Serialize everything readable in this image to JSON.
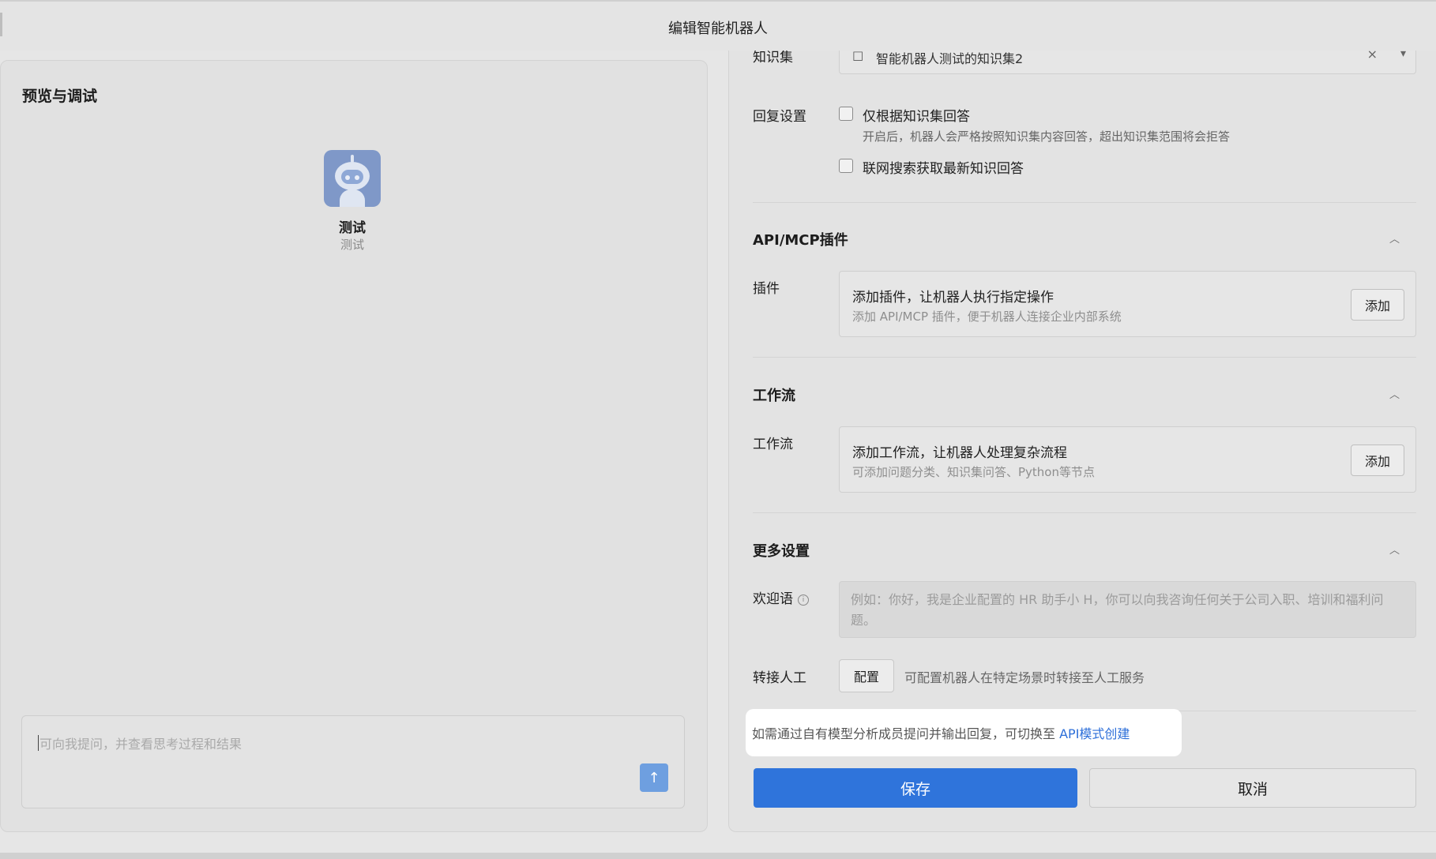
{
  "window": {
    "title": "编辑智能机器人"
  },
  "preview": {
    "title": "预览与调试",
    "bot": {
      "name": "测试",
      "description": "测试"
    },
    "input_placeholder": "可向我提问，并查看思考过程和结果",
    "send_icon": "arrow-up-icon"
  },
  "config": {
    "knowledge": {
      "label": "知识集",
      "value": "智能机器人测试的知识集2",
      "clear_icon": "×",
      "chevron": "⌄"
    },
    "reply": {
      "label": "回复设置",
      "only_kb": {
        "label": "仅根据知识集回答",
        "checked": false,
        "hint": "开启后，机器人会严格按照知识集内容回答，超出知识集范围将会拒答"
      },
      "web_search": {
        "label": "联网搜索获取最新知识回答",
        "checked": false
      }
    },
    "plugins": {
      "section_title": "API/MCP插件",
      "label": "插件",
      "card_title": "添加插件，让机器人执行指定操作",
      "card_desc": "添加 API/MCP 插件，便于机器人连接企业内部系统",
      "add_label": "添加"
    },
    "workflow": {
      "section_title": "工作流",
      "label": "工作流",
      "card_title": "添加工作流，让机器人处理复杂流程",
      "card_desc": "可添加问题分类、知识集问答、Python等节点",
      "add_label": "添加"
    },
    "more": {
      "section_title": "更多设置",
      "greeting_label": "欢迎语",
      "greeting_placeholder": "例如：你好，我是企业配置的 HR 助手小 H，你可以向我咨询任何关于公司入职、培训和福利问题。",
      "handoff_label": "转接人工",
      "handoff_button": "配置",
      "handoff_hint": "可配置机器人在特定场景时转接至人工服务"
    },
    "tooltip": {
      "text": "如需通过自有模型分析成员提问并输出回复，可切换至 ",
      "link": "API模式创建"
    },
    "save_label": "保存",
    "cancel_label": "取消"
  },
  "colors": {
    "primary": "#2f74db",
    "link": "#2d6fd9",
    "send": "#6e9fe0"
  }
}
